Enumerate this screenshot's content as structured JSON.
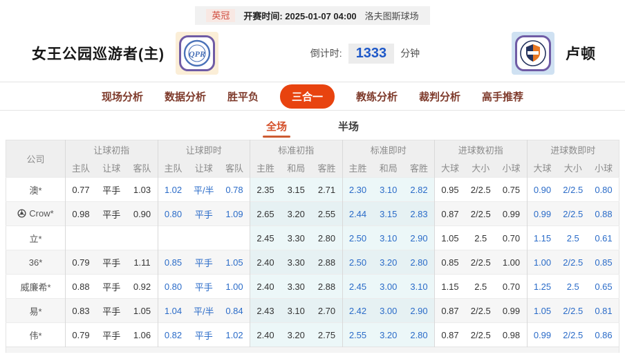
{
  "top_bar": {
    "league": "英冠",
    "kickoff_label": "开赛时间:",
    "kickoff_time": "2025-01-07 04:00",
    "venue": "洛夫图斯球场"
  },
  "match_header": {
    "home_team": "女王公园巡游者(主)",
    "away_team": "卢顿",
    "home_logo": "qpr-crest",
    "away_logo": "luton-town-crest",
    "countdown_label": "倒计时:",
    "countdown_value": "1333",
    "countdown_unit": "分钟"
  },
  "nav_tabs": [
    {
      "label": "现场分析",
      "active": false
    },
    {
      "label": "数据分析",
      "active": false
    },
    {
      "label": "胜平负",
      "active": false
    },
    {
      "label": "三合一",
      "active": true
    },
    {
      "label": "教练分析",
      "active": false
    },
    {
      "label": "裁判分析",
      "active": false
    },
    {
      "label": "高手推荐",
      "active": false
    }
  ],
  "sub_tabs": [
    {
      "label": "全场",
      "active": true
    },
    {
      "label": "半场",
      "active": false
    }
  ],
  "table": {
    "company_header": "公司",
    "groups": [
      {
        "label": "让球初指",
        "cols": [
          "主队",
          "让球",
          "客队"
        ],
        "live": false,
        "tinted": false
      },
      {
        "label": "让球即时",
        "cols": [
          "主队",
          "让球",
          "客队"
        ],
        "live": true,
        "tinted": false
      },
      {
        "label": "标准初指",
        "cols": [
          "主胜",
          "和局",
          "客胜"
        ],
        "live": false,
        "tinted": true
      },
      {
        "label": "标准即时",
        "cols": [
          "主胜",
          "和局",
          "客胜"
        ],
        "live": true,
        "tinted": true
      },
      {
        "label": "进球数初指",
        "cols": [
          "大球",
          "大小",
          "小球"
        ],
        "live": false,
        "tinted": false
      },
      {
        "label": "进球数即时",
        "cols": [
          "大球",
          "大小",
          "小球"
        ],
        "live": true,
        "tinted": false
      }
    ],
    "rows": [
      {
        "company": "澳*",
        "icon": null,
        "cells": [
          [
            "0.77",
            "平手",
            "1.03"
          ],
          [
            "1.02",
            "平/半",
            "0.78"
          ],
          [
            "2.35",
            "3.15",
            "2.71"
          ],
          [
            "2.30",
            "3.10",
            "2.82"
          ],
          [
            "0.95",
            "2/2.5",
            "0.75"
          ],
          [
            "0.90",
            "2/2.5",
            "0.80"
          ]
        ]
      },
      {
        "company": "Crow*",
        "icon": "soccer-ball",
        "cells": [
          [
            "0.98",
            "平手",
            "0.90"
          ],
          [
            "0.80",
            "平手",
            "1.09"
          ],
          [
            "2.65",
            "3.20",
            "2.55"
          ],
          [
            "2.44",
            "3.15",
            "2.83"
          ],
          [
            "0.87",
            "2/2.5",
            "0.99"
          ],
          [
            "0.99",
            "2/2.5",
            "0.88"
          ]
        ]
      },
      {
        "company": "立*",
        "icon": null,
        "cells": [
          [
            "",
            "",
            ""
          ],
          [
            "",
            "",
            ""
          ],
          [
            "2.45",
            "3.30",
            "2.80"
          ],
          [
            "2.50",
            "3.10",
            "2.90"
          ],
          [
            "1.05",
            "2.5",
            "0.70"
          ],
          [
            "1.15",
            "2.5",
            "0.61"
          ]
        ]
      },
      {
        "company": "36*",
        "icon": null,
        "cells": [
          [
            "0.79",
            "平手",
            "1.11"
          ],
          [
            "0.85",
            "平手",
            "1.05"
          ],
          [
            "2.40",
            "3.30",
            "2.88"
          ],
          [
            "2.50",
            "3.20",
            "2.80"
          ],
          [
            "0.85",
            "2/2.5",
            "1.00"
          ],
          [
            "1.00",
            "2/2.5",
            "0.85"
          ]
        ]
      },
      {
        "company": "威廉希*",
        "icon": null,
        "cells": [
          [
            "0.88",
            "平手",
            "0.92"
          ],
          [
            "0.80",
            "平手",
            "1.00"
          ],
          [
            "2.40",
            "3.30",
            "2.88"
          ],
          [
            "2.45",
            "3.00",
            "3.10"
          ],
          [
            "1.15",
            "2.5",
            "0.70"
          ],
          [
            "1.25",
            "2.5",
            "0.65"
          ]
        ]
      },
      {
        "company": "易*",
        "icon": null,
        "cells": [
          [
            "0.83",
            "平手",
            "1.05"
          ],
          [
            "1.04",
            "平/半",
            "0.84"
          ],
          [
            "2.43",
            "3.10",
            "2.70"
          ],
          [
            "2.42",
            "3.00",
            "2.90"
          ],
          [
            "0.87",
            "2/2.5",
            "0.99"
          ],
          [
            "1.05",
            "2/2.5",
            "0.81"
          ]
        ]
      },
      {
        "company": "伟*",
        "icon": null,
        "cells": [
          [
            "0.79",
            "平手",
            "1.06"
          ],
          [
            "0.82",
            "平手",
            "1.02"
          ],
          [
            "2.40",
            "3.20",
            "2.75"
          ],
          [
            "2.55",
            "3.20",
            "2.80"
          ],
          [
            "0.87",
            "2/2.5",
            "0.98"
          ],
          [
            "0.99",
            "2/2.5",
            "0.86"
          ]
        ]
      }
    ]
  },
  "colors": {
    "accent_orange": "#e8430f",
    "tab_text": "#7e3a2b",
    "live_blue": "#2a6bc8",
    "countdown_blue": "#1e58c8",
    "league_red": "#cf4a3c",
    "std_tint": "#ecf7f8",
    "header_gray": "#efefef"
  }
}
